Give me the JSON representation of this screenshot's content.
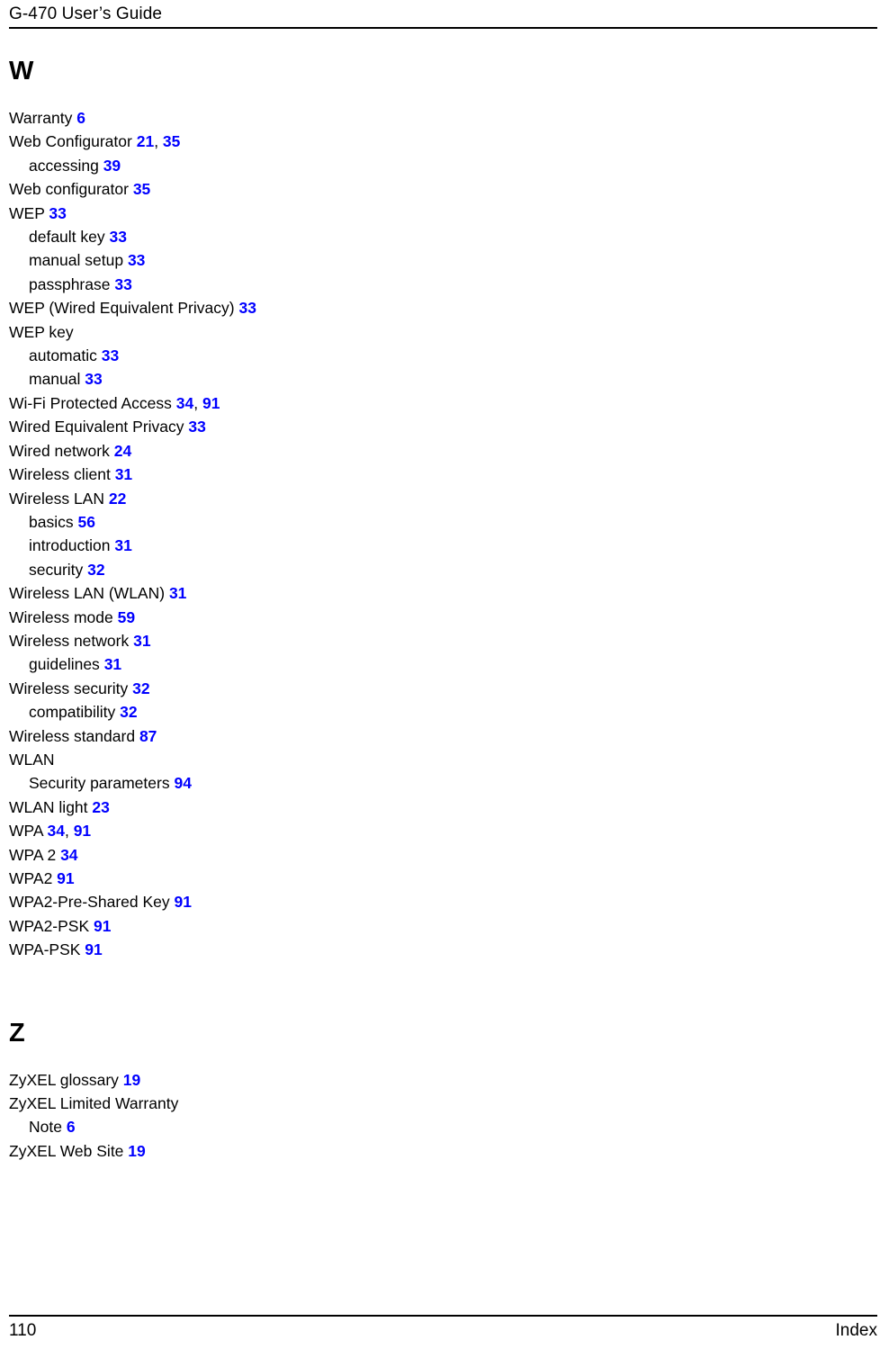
{
  "header": {
    "title": "G-470 User’s Guide"
  },
  "footer": {
    "page_number": "110",
    "section_label": "Index"
  },
  "sections": [
    {
      "letter": "W",
      "entries": [
        {
          "label": "Warranty",
          "level": 0,
          "pages": [
            "6"
          ]
        },
        {
          "label": "Web Configurator",
          "level": 0,
          "pages": [
            "21",
            "35"
          ]
        },
        {
          "label": "accessing",
          "level": 1,
          "pages": [
            "39"
          ]
        },
        {
          "label": "Web configurator",
          "level": 0,
          "pages": [
            "35"
          ]
        },
        {
          "label": "WEP",
          "level": 0,
          "pages": [
            "33"
          ]
        },
        {
          "label": "default key",
          "level": 1,
          "pages": [
            "33"
          ]
        },
        {
          "label": "manual setup",
          "level": 1,
          "pages": [
            "33"
          ]
        },
        {
          "label": "passphrase",
          "level": 1,
          "pages": [
            "33"
          ]
        },
        {
          "label": "WEP (Wired Equivalent Privacy)",
          "level": 0,
          "pages": [
            "33"
          ]
        },
        {
          "label": "WEP key",
          "level": 0,
          "pages": []
        },
        {
          "label": "automatic",
          "level": 1,
          "pages": [
            "33"
          ]
        },
        {
          "label": "manual",
          "level": 1,
          "pages": [
            "33"
          ]
        },
        {
          "label": "Wi-Fi Protected Access",
          "level": 0,
          "pages": [
            "34",
            "91"
          ]
        },
        {
          "label": "Wired Equivalent Privacy",
          "level": 0,
          "pages": [
            "33"
          ]
        },
        {
          "label": "Wired network",
          "level": 0,
          "pages": [
            "24"
          ]
        },
        {
          "label": "Wireless client",
          "level": 0,
          "pages": [
            "31"
          ]
        },
        {
          "label": "Wireless LAN",
          "level": 0,
          "pages": [
            "22"
          ]
        },
        {
          "label": "basics",
          "level": 1,
          "pages": [
            "56"
          ]
        },
        {
          "label": "introduction",
          "level": 1,
          "pages": [
            "31"
          ]
        },
        {
          "label": "security",
          "level": 1,
          "pages": [
            "32"
          ]
        },
        {
          "label": "Wireless LAN (WLAN)",
          "level": 0,
          "pages": [
            "31"
          ]
        },
        {
          "label": "Wireless mode",
          "level": 0,
          "pages": [
            "59"
          ]
        },
        {
          "label": "Wireless network",
          "level": 0,
          "pages": [
            "31"
          ]
        },
        {
          "label": "guidelines",
          "level": 1,
          "pages": [
            "31"
          ]
        },
        {
          "label": "Wireless security",
          "level": 0,
          "pages": [
            "32"
          ]
        },
        {
          "label": "compatibility",
          "level": 1,
          "pages": [
            "32"
          ]
        },
        {
          "label": "Wireless standard",
          "level": 0,
          "pages": [
            "87"
          ]
        },
        {
          "label": "WLAN",
          "level": 0,
          "pages": []
        },
        {
          "label": "Security parameters",
          "level": 1,
          "pages": [
            "94"
          ]
        },
        {
          "label": "WLAN light",
          "level": 0,
          "pages": [
            "23"
          ]
        },
        {
          "label": "WPA",
          "level": 0,
          "pages": [
            "34",
            "91"
          ]
        },
        {
          "label": "WPA 2",
          "level": 0,
          "pages": [
            "34"
          ]
        },
        {
          "label": "WPA2",
          "level": 0,
          "pages": [
            "91"
          ]
        },
        {
          "label": "WPA2-Pre-Shared Key",
          "level": 0,
          "pages": [
            "91"
          ]
        },
        {
          "label": "WPA2-PSK",
          "level": 0,
          "pages": [
            "91"
          ]
        },
        {
          "label": "WPA-PSK",
          "level": 0,
          "pages": [
            "91"
          ]
        }
      ]
    },
    {
      "letter": "Z",
      "entries": [
        {
          "label": "ZyXEL glossary",
          "level": 0,
          "pages": [
            "19"
          ]
        },
        {
          "label": "ZyXEL Limited Warranty",
          "level": 0,
          "pages": []
        },
        {
          "label": "Note",
          "level": 1,
          "pages": [
            "6"
          ]
        },
        {
          "label": "ZyXEL Web Site",
          "level": 0,
          "pages": [
            "19"
          ]
        }
      ]
    }
  ],
  "colors": {
    "page_number_link": "#0000ff",
    "text": "#000000",
    "background": "#ffffff"
  }
}
